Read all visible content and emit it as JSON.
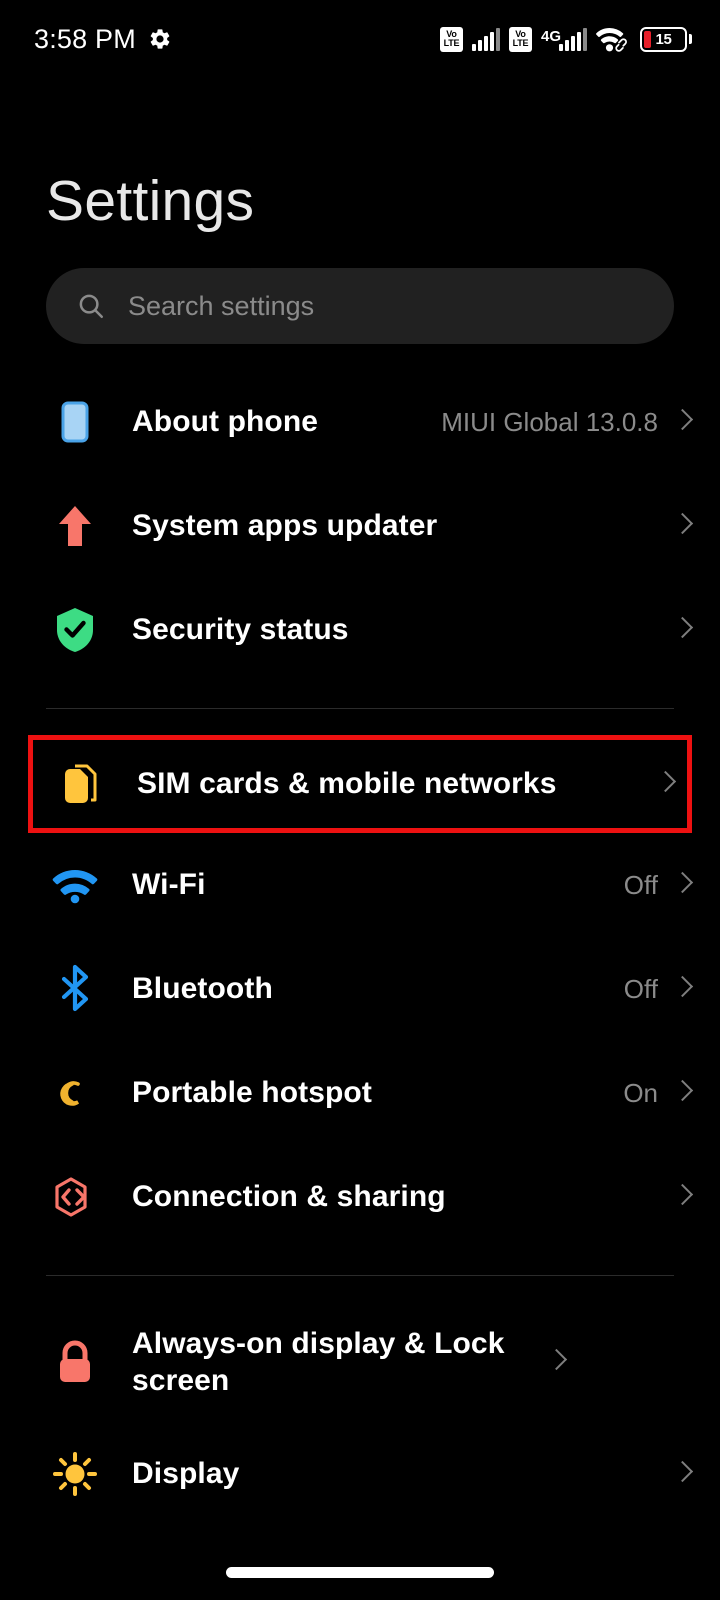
{
  "statusbar": {
    "time": "3:58 PM",
    "gear_icon": "gear-icon",
    "sim1_volte": "VoLTE",
    "sim1_volte_line1": "Vo",
    "sim1_volte_line2": "LTE",
    "sim2_volte_line1": "Vo",
    "sim2_volte_line2": "LTE",
    "network_type": "4G",
    "wifi_icon": "wifi-icon",
    "battery_level": "15"
  },
  "header": {
    "title": "Settings"
  },
  "search": {
    "placeholder": "Search settings",
    "icon": "search-icon"
  },
  "groups": [
    {
      "id": "device-group",
      "rows": [
        {
          "id": "about-phone",
          "icon": "phone-icon",
          "label": "About phone",
          "value": "MIUI Global 13.0.8",
          "highlighted": false
        },
        {
          "id": "system-apps-updater",
          "icon": "up-arrow-icon",
          "label": "System apps updater",
          "value": "",
          "highlighted": false
        },
        {
          "id": "security-status",
          "icon": "shield-check-icon",
          "label": "Security status",
          "value": "",
          "highlighted": false
        }
      ]
    },
    {
      "id": "connectivity-group",
      "rows": [
        {
          "id": "sim-cards-mobile-networks",
          "icon": "sim-card-icon",
          "label": "SIM cards & mobile networks",
          "value": "",
          "highlighted": true
        },
        {
          "id": "wifi",
          "icon": "wifi-icon",
          "label": "Wi-Fi",
          "value": "Off",
          "highlighted": false
        },
        {
          "id": "bluetooth",
          "icon": "bluetooth-icon",
          "label": "Bluetooth",
          "value": "Off",
          "highlighted": false
        },
        {
          "id": "portable-hotspot",
          "icon": "hotspot-icon",
          "label": "Portable hotspot",
          "value": "On",
          "highlighted": false
        },
        {
          "id": "connection-sharing",
          "icon": "connection-sharing-icon",
          "label": "Connection & sharing",
          "value": "",
          "highlighted": false
        }
      ]
    },
    {
      "id": "display-group",
      "rows": [
        {
          "id": "always-on-display-lock-screen",
          "icon": "lock-icon",
          "label": "Always-on display & Lock screen",
          "value": "",
          "highlighted": false
        },
        {
          "id": "display",
          "icon": "brightness-icon",
          "label": "Display",
          "value": "",
          "highlighted": false
        }
      ]
    }
  ],
  "colors": {
    "background": "#000000",
    "highlight_border": "#ee1111",
    "phone_icon": "#a8d4f5",
    "phone_icon_border": "#4aa3e8",
    "updater_icon": "#f8766a",
    "shield_icon": "#3ddc84",
    "sim_icon": "#ffc53d",
    "wifi_icon": "#2196f3",
    "bluetooth_icon": "#2196f3",
    "hotspot_icon": "#f0b22e",
    "connection_icon": "#f8766a",
    "lock_icon": "#f8766a",
    "display_icon": "#ffc53d",
    "search_bg": "#212121",
    "value_text": "#8b8b8b",
    "battery_low": "#e8202a"
  }
}
